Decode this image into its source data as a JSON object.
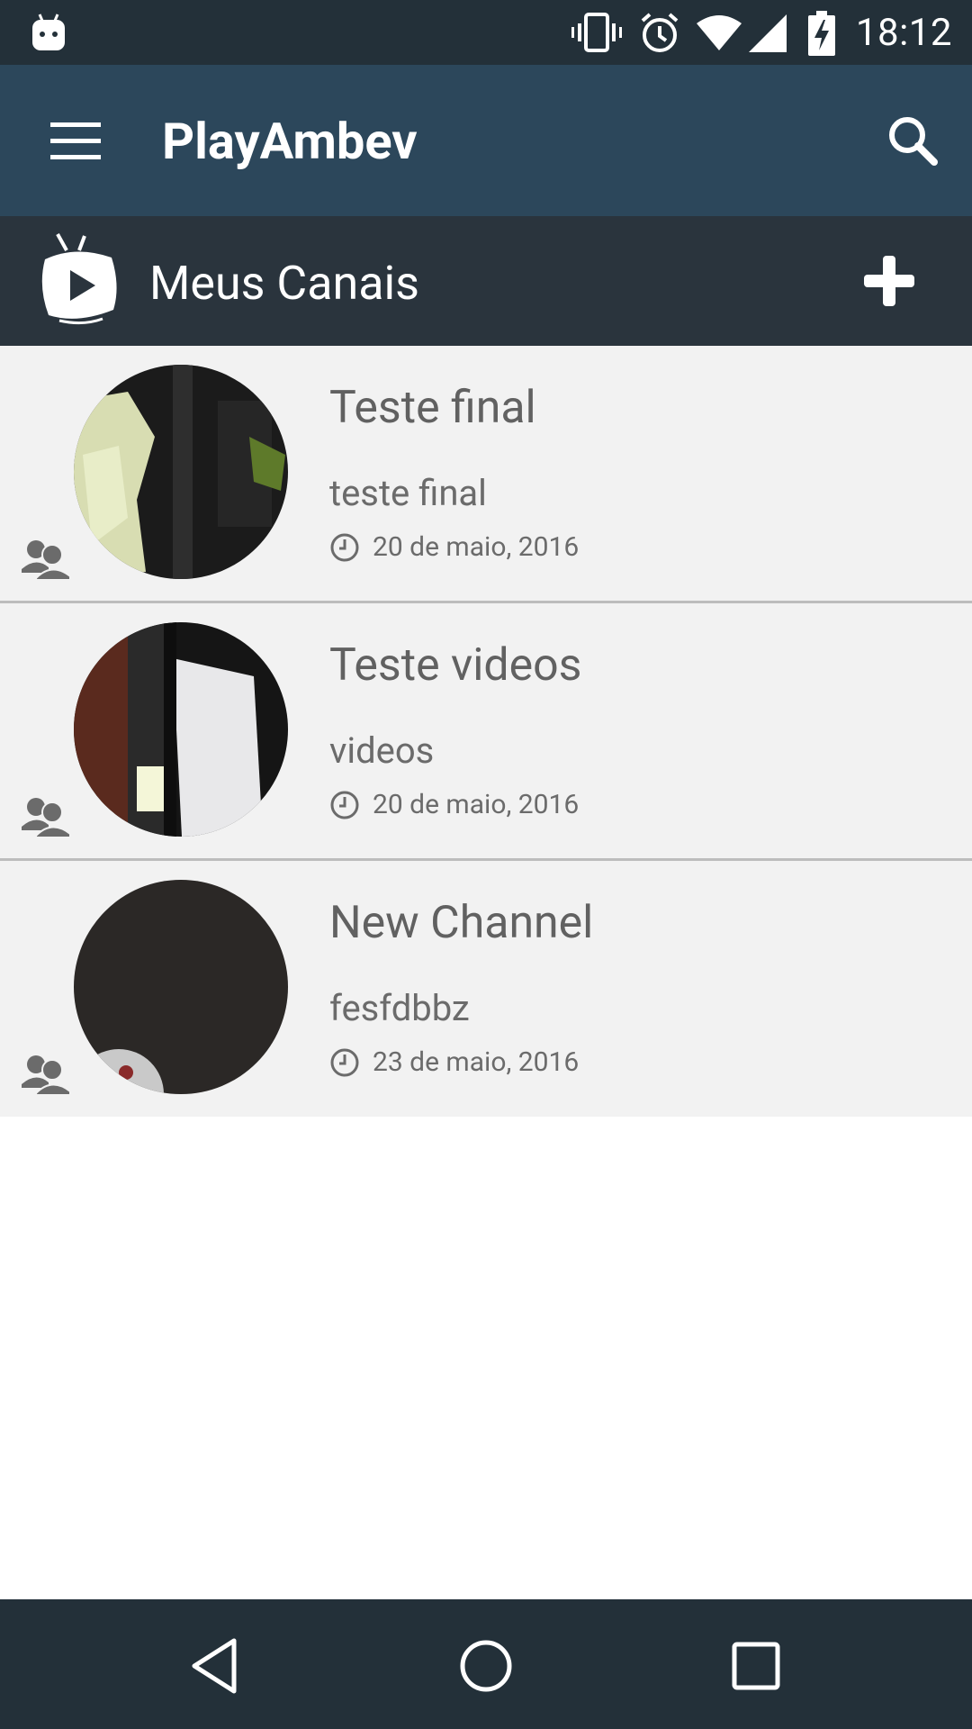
{
  "status_bar": {
    "time": "18:12"
  },
  "app_bar": {
    "title": "PlayAmbev"
  },
  "section": {
    "title": "Meus Canais"
  },
  "channels": [
    {
      "name": "Teste final",
      "description": "teste final",
      "date": "20 de maio, 2016"
    },
    {
      "name": "Teste videos",
      "description": "videos",
      "date": "20 de maio, 2016"
    },
    {
      "name": "New Channel",
      "description": "fesfdbbz",
      "date": "23 de maio, 2016"
    }
  ],
  "colors": {
    "status_bar": "#233039",
    "app_bar": "#2c475b",
    "section_header": "#2a343d",
    "list_bg": "#f2f2f2",
    "nav_bar": "#233039"
  }
}
